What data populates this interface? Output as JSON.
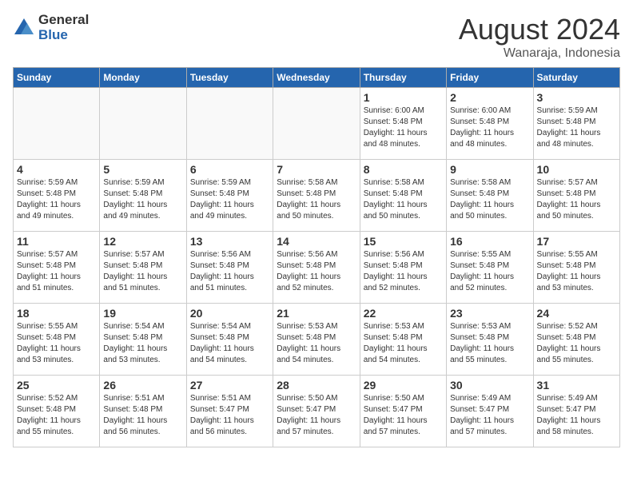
{
  "header": {
    "logo_general": "General",
    "logo_blue": "Blue",
    "month_title": "August 2024",
    "location": "Wanaraja, Indonesia"
  },
  "days_of_week": [
    "Sunday",
    "Monday",
    "Tuesday",
    "Wednesday",
    "Thursday",
    "Friday",
    "Saturday"
  ],
  "weeks": [
    [
      {
        "day": "",
        "info": ""
      },
      {
        "day": "",
        "info": ""
      },
      {
        "day": "",
        "info": ""
      },
      {
        "day": "",
        "info": ""
      },
      {
        "day": "1",
        "info": "Sunrise: 6:00 AM\nSunset: 5:48 PM\nDaylight: 11 hours\nand 48 minutes."
      },
      {
        "day": "2",
        "info": "Sunrise: 6:00 AM\nSunset: 5:48 PM\nDaylight: 11 hours\nand 48 minutes."
      },
      {
        "day": "3",
        "info": "Sunrise: 5:59 AM\nSunset: 5:48 PM\nDaylight: 11 hours\nand 48 minutes."
      }
    ],
    [
      {
        "day": "4",
        "info": "Sunrise: 5:59 AM\nSunset: 5:48 PM\nDaylight: 11 hours\nand 49 minutes."
      },
      {
        "day": "5",
        "info": "Sunrise: 5:59 AM\nSunset: 5:48 PM\nDaylight: 11 hours\nand 49 minutes."
      },
      {
        "day": "6",
        "info": "Sunrise: 5:59 AM\nSunset: 5:48 PM\nDaylight: 11 hours\nand 49 minutes."
      },
      {
        "day": "7",
        "info": "Sunrise: 5:58 AM\nSunset: 5:48 PM\nDaylight: 11 hours\nand 50 minutes."
      },
      {
        "day": "8",
        "info": "Sunrise: 5:58 AM\nSunset: 5:48 PM\nDaylight: 11 hours\nand 50 minutes."
      },
      {
        "day": "9",
        "info": "Sunrise: 5:58 AM\nSunset: 5:48 PM\nDaylight: 11 hours\nand 50 minutes."
      },
      {
        "day": "10",
        "info": "Sunrise: 5:57 AM\nSunset: 5:48 PM\nDaylight: 11 hours\nand 50 minutes."
      }
    ],
    [
      {
        "day": "11",
        "info": "Sunrise: 5:57 AM\nSunset: 5:48 PM\nDaylight: 11 hours\nand 51 minutes."
      },
      {
        "day": "12",
        "info": "Sunrise: 5:57 AM\nSunset: 5:48 PM\nDaylight: 11 hours\nand 51 minutes."
      },
      {
        "day": "13",
        "info": "Sunrise: 5:56 AM\nSunset: 5:48 PM\nDaylight: 11 hours\nand 51 minutes."
      },
      {
        "day": "14",
        "info": "Sunrise: 5:56 AM\nSunset: 5:48 PM\nDaylight: 11 hours\nand 52 minutes."
      },
      {
        "day": "15",
        "info": "Sunrise: 5:56 AM\nSunset: 5:48 PM\nDaylight: 11 hours\nand 52 minutes."
      },
      {
        "day": "16",
        "info": "Sunrise: 5:55 AM\nSunset: 5:48 PM\nDaylight: 11 hours\nand 52 minutes."
      },
      {
        "day": "17",
        "info": "Sunrise: 5:55 AM\nSunset: 5:48 PM\nDaylight: 11 hours\nand 53 minutes."
      }
    ],
    [
      {
        "day": "18",
        "info": "Sunrise: 5:55 AM\nSunset: 5:48 PM\nDaylight: 11 hours\nand 53 minutes."
      },
      {
        "day": "19",
        "info": "Sunrise: 5:54 AM\nSunset: 5:48 PM\nDaylight: 11 hours\nand 53 minutes."
      },
      {
        "day": "20",
        "info": "Sunrise: 5:54 AM\nSunset: 5:48 PM\nDaylight: 11 hours\nand 54 minutes."
      },
      {
        "day": "21",
        "info": "Sunrise: 5:53 AM\nSunset: 5:48 PM\nDaylight: 11 hours\nand 54 minutes."
      },
      {
        "day": "22",
        "info": "Sunrise: 5:53 AM\nSunset: 5:48 PM\nDaylight: 11 hours\nand 54 minutes."
      },
      {
        "day": "23",
        "info": "Sunrise: 5:53 AM\nSunset: 5:48 PM\nDaylight: 11 hours\nand 55 minutes."
      },
      {
        "day": "24",
        "info": "Sunrise: 5:52 AM\nSunset: 5:48 PM\nDaylight: 11 hours\nand 55 minutes."
      }
    ],
    [
      {
        "day": "25",
        "info": "Sunrise: 5:52 AM\nSunset: 5:48 PM\nDaylight: 11 hours\nand 55 minutes."
      },
      {
        "day": "26",
        "info": "Sunrise: 5:51 AM\nSunset: 5:48 PM\nDaylight: 11 hours\nand 56 minutes."
      },
      {
        "day": "27",
        "info": "Sunrise: 5:51 AM\nSunset: 5:47 PM\nDaylight: 11 hours\nand 56 minutes."
      },
      {
        "day": "28",
        "info": "Sunrise: 5:50 AM\nSunset: 5:47 PM\nDaylight: 11 hours\nand 57 minutes."
      },
      {
        "day": "29",
        "info": "Sunrise: 5:50 AM\nSunset: 5:47 PM\nDaylight: 11 hours\nand 57 minutes."
      },
      {
        "day": "30",
        "info": "Sunrise: 5:49 AM\nSunset: 5:47 PM\nDaylight: 11 hours\nand 57 minutes."
      },
      {
        "day": "31",
        "info": "Sunrise: 5:49 AM\nSunset: 5:47 PM\nDaylight: 11 hours\nand 58 minutes."
      }
    ]
  ]
}
